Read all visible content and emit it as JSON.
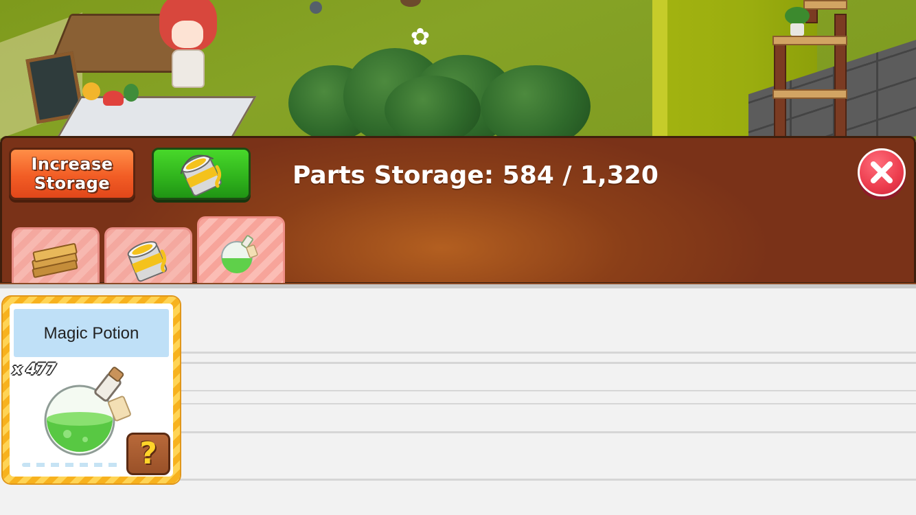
{
  "panel": {
    "increase_storage_label": "Increase\nStorage",
    "title": "Parts Storage: 584 / 1,320",
    "tabs": [
      {
        "name": "planks",
        "icon": "wood-planks-icon"
      },
      {
        "name": "paint",
        "icon": "paint-bucket-icon"
      },
      {
        "name": "potions",
        "icon": "potion-icon",
        "active": true
      }
    ],
    "colors": {
      "panel_brown": "#8b3f18",
      "increase_orange": "#f25d25",
      "paint_green": "#2fb21c",
      "close_red": "#ec3c4d"
    }
  },
  "items": [
    {
      "name": "Magic Potion",
      "count": "x 477",
      "icon": "potion-icon",
      "help_label": "?"
    }
  ]
}
